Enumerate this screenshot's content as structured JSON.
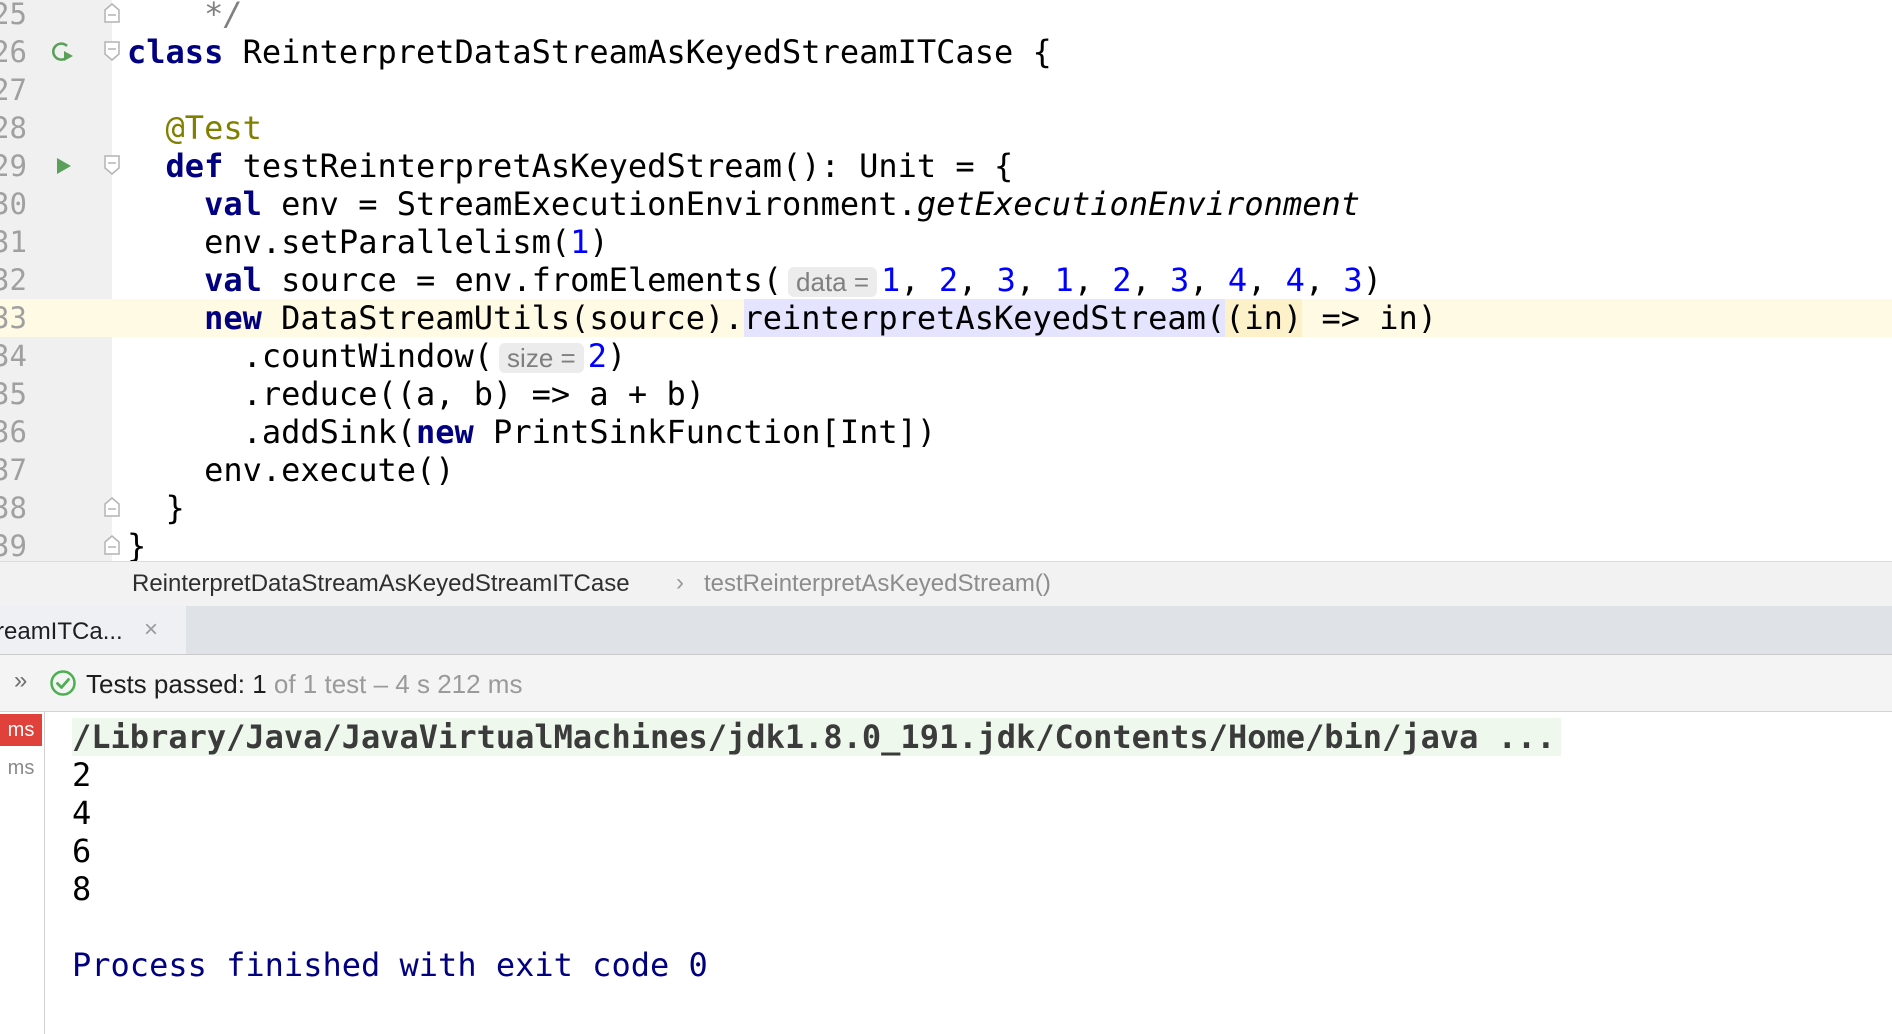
{
  "editor": {
    "lines": [
      {
        "number": "25",
        "fold": "end",
        "tokens": [
          {
            "text": "    "
          },
          {
            "text": "*/",
            "cls": "comment"
          }
        ]
      },
      {
        "number": "26",
        "run": "class",
        "fold": "start",
        "tokens": [
          {
            "text": "class",
            "cls": "kw"
          },
          {
            "text": " ReinterpretDataStreamAsKeyedStreamITCase {"
          }
        ]
      },
      {
        "number": "27",
        "tokens": []
      },
      {
        "number": "28",
        "tokens": [
          {
            "text": "  "
          },
          {
            "text": "@Test",
            "cls": "ann"
          }
        ]
      },
      {
        "number": "29",
        "run": "method",
        "fold": "start",
        "tokens": [
          {
            "text": "  "
          },
          {
            "text": "def",
            "cls": "kw"
          },
          {
            "text": " testReinterpretAsKeyedStream(): Unit = {"
          }
        ]
      },
      {
        "number": "30",
        "tokens": [
          {
            "text": "    "
          },
          {
            "text": "val",
            "cls": "kw"
          },
          {
            "text": " env = StreamExecutionEnvironment."
          },
          {
            "text": "getExecutionEnvironment",
            "cls": "it"
          }
        ]
      },
      {
        "number": "31",
        "tokens": [
          {
            "text": "    env.setParallelism("
          },
          {
            "text": "1",
            "cls": "num"
          },
          {
            "text": ")"
          }
        ]
      },
      {
        "number": "32",
        "tokens": [
          {
            "text": "    "
          },
          {
            "text": "val",
            "cls": "kw"
          },
          {
            "text": " source = env.fromElements("
          },
          {
            "text": "data =",
            "cls": "hint"
          },
          {
            "text": "1",
            "cls": "num"
          },
          {
            "text": ", "
          },
          {
            "text": "2",
            "cls": "num"
          },
          {
            "text": ", "
          },
          {
            "text": "3",
            "cls": "num"
          },
          {
            "text": ", "
          },
          {
            "text": "1",
            "cls": "num"
          },
          {
            "text": ", "
          },
          {
            "text": "2",
            "cls": "num"
          },
          {
            "text": ", "
          },
          {
            "text": "3",
            "cls": "num"
          },
          {
            "text": ", "
          },
          {
            "text": "4",
            "cls": "num"
          },
          {
            "text": ", "
          },
          {
            "text": "4",
            "cls": "num"
          },
          {
            "text": ", "
          },
          {
            "text": "3",
            "cls": "num"
          },
          {
            "text": ")"
          }
        ]
      },
      {
        "number": "33",
        "current": true,
        "tokens": [
          {
            "text": "    "
          },
          {
            "text": "new",
            "cls": "kw"
          },
          {
            "text": " DataStreamUtils(source)."
          },
          {
            "text": "reinterpretAsKeyedStream(",
            "cls": "hl-method"
          },
          {
            "text": "(in)",
            "cls": "hl-param"
          },
          {
            "text": " => in)"
          }
        ]
      },
      {
        "number": "34",
        "tokens": [
          {
            "text": "      .countWindow("
          },
          {
            "text": "size =",
            "cls": "hint"
          },
          {
            "text": "2",
            "cls": "num"
          },
          {
            "text": ")"
          }
        ]
      },
      {
        "number": "35",
        "tokens": [
          {
            "text": "      .reduce((a, b) => a + b)"
          }
        ]
      },
      {
        "number": "36",
        "tokens": [
          {
            "text": "      .addSink("
          },
          {
            "text": "new",
            "cls": "kw"
          },
          {
            "text": " PrintSinkFunction[Int])"
          }
        ]
      },
      {
        "number": "37",
        "tokens": [
          {
            "text": "    env.execute()"
          }
        ]
      },
      {
        "number": "38",
        "fold": "end",
        "tokens": [
          {
            "text": "  }"
          }
        ]
      },
      {
        "number": "39",
        "fold": "end",
        "tokens": [
          {
            "text": "}"
          }
        ]
      }
    ]
  },
  "breadcrumb": {
    "class_name": "ReinterpretDataStreamAsKeyedStreamITCase",
    "separator": "›",
    "method_name": "testReinterpretAsKeyedStream()"
  },
  "run_panel": {
    "tab_label": "reamITCa...",
    "tab_close": "×",
    "expand_glyph": "»",
    "status_strong": "Tests passed: 1",
    "status_rest": " of 1 test – 4 s 212 ms",
    "gutter_badges": [
      "ms",
      "ms"
    ],
    "console_lines": [
      "/Library/Java/JavaVirtualMachines/jdk1.8.0_191.jdk/Contents/Home/bin/java ...",
      "2",
      "4",
      "6",
      "8",
      "",
      "Process finished with exit code 0"
    ]
  },
  "colors": {
    "keyword": "#000080",
    "number": "#0000ff",
    "annotation": "#808000",
    "pass_green": "#4caf50",
    "error_badge": "#e0413a"
  }
}
